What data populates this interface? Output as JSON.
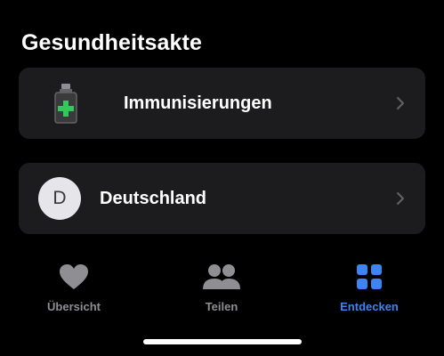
{
  "section": {
    "title": "Gesundheitsakte"
  },
  "records": [
    {
      "label": "Immunisierungen",
      "icon": "vaccine-vial-icon"
    },
    {
      "label": "Deutschland",
      "avatar_letter": "D"
    }
  ],
  "tabbar": {
    "tabs": [
      {
        "label": "Übersicht",
        "icon": "heart-icon",
        "selected": false
      },
      {
        "label": "Teilen",
        "icon": "people-icon",
        "selected": false
      },
      {
        "label": "Entdecken",
        "icon": "grid-icon",
        "selected": true
      }
    ]
  },
  "colors": {
    "background": "#000000",
    "card": "#1c1c1e",
    "accent": "#3f84f2",
    "inactive": "#8e8e93",
    "vaccine_green": "#34c759"
  }
}
